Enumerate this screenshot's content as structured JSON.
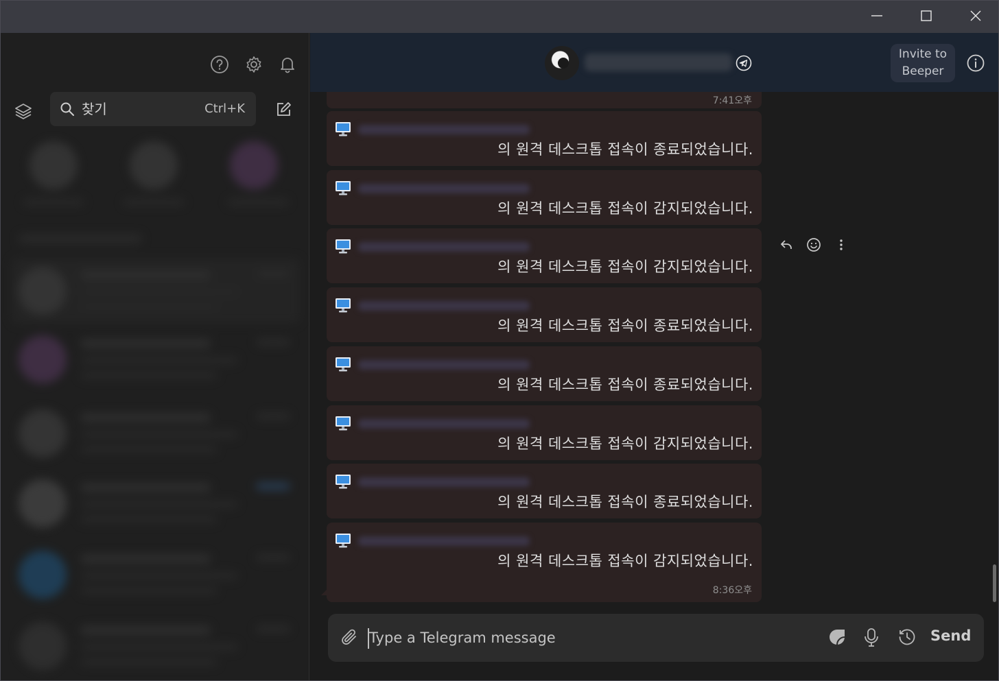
{
  "window": {
    "minimize_icon": "minimize-icon",
    "maximize_icon": "maximize-icon",
    "close_icon": "close-icon"
  },
  "sidebar": {
    "search": {
      "placeholder": "찾기",
      "shortcut": "Ctrl+K"
    },
    "icons": [
      "help-icon",
      "gear-icon",
      "bell-icon",
      "layers-icon",
      "compose-icon"
    ]
  },
  "chat_header": {
    "invite_label": "Invite to Beeper",
    "network_icon": "telegram-icon",
    "info_icon": "info-icon"
  },
  "messages": {
    "top_partial_time": "7:41오후",
    "items": [
      {
        "text": "의 원격 데스크톱 접속이 종료되었습니다."
      },
      {
        "text": "의 원격 데스크톱 접속이 감지되었습니다."
      },
      {
        "text": "의 원격 데스크톱 접속이 감지되었습니다."
      },
      {
        "text": "의 원격 데스크톱 접속이 종료되었습니다."
      },
      {
        "text": "의 원격 데스크톱 접속이 종료되었습니다."
      },
      {
        "text": "의 원격 데스크톱 접속이 감지되었습니다."
      },
      {
        "text": "의 원격 데스크톱 접속이 종료되었습니다."
      },
      {
        "text": "의 원격 데스크톱 접속이 감지되었습니다.",
        "time": "8:36오후"
      }
    ],
    "hover_actions": [
      "reply-icon",
      "emoji-react-icon",
      "more-options-icon"
    ]
  },
  "composer": {
    "placeholder": "Type a Telegram message",
    "send_label": "Send",
    "icons": [
      "attach-icon",
      "sticker-icon",
      "microphone-icon",
      "schedule-icon"
    ]
  },
  "colors": {
    "titlebar": "#3a3b42",
    "sidebar": "#1f1f1f",
    "header": "#1b2431",
    "bubble": "#2c2222",
    "composer": "#2c2c2c"
  }
}
